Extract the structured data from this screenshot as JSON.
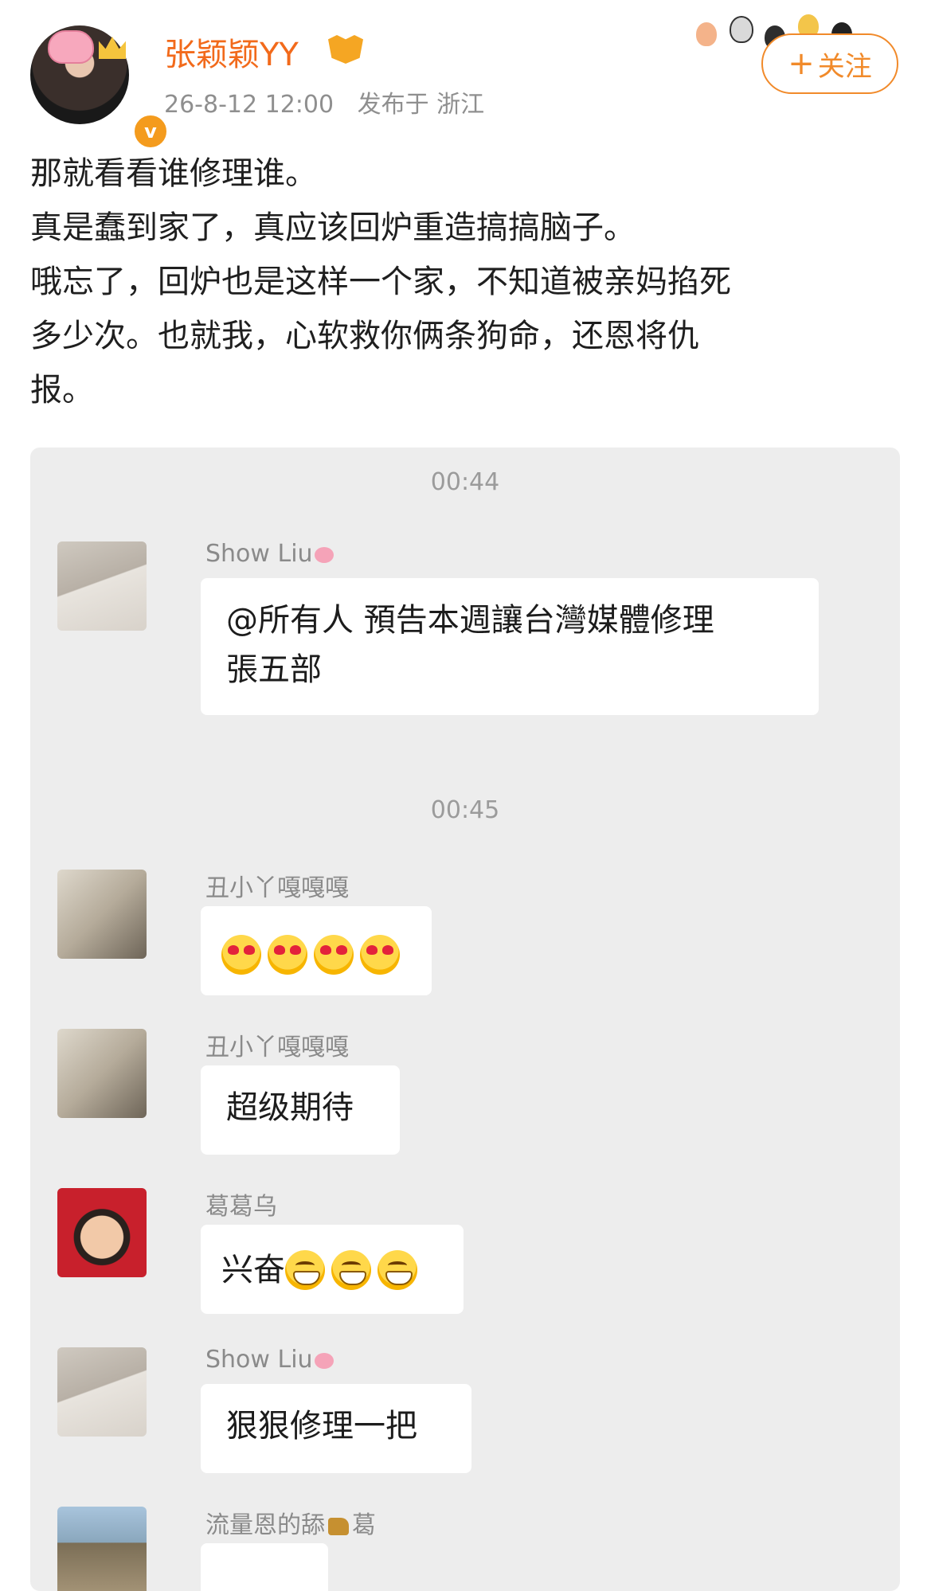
{
  "post": {
    "username": "张颖颖YY",
    "timestamp": "26-8-12 12:00",
    "location_prefix": "发布于",
    "location": "浙江",
    "follow_label": "关注",
    "follow_plus": "+",
    "verified_mark": "v",
    "lines": [
      "那就看看谁修理谁。",
      "真是蠢到家了，真应该回炉重造搞搞脑子。",
      "哦忘了，回炉也是这样一个家，不知道被亲妈掐死",
      "多少次。也就我，心软救你俩条狗命，还恩将仇",
      "报。"
    ]
  },
  "chat": {
    "time_1": "00:44",
    "time_2": "00:45",
    "messages": [
      {
        "sender": "Show Liu",
        "line1": "@所有人  預告本週讓台灣媒體修理",
        "line2": "張五部"
      },
      {
        "sender": "丑小丫嘎嘎嘎"
      },
      {
        "sender": "丑小丫嘎嘎嘎",
        "text": "超级期待"
      },
      {
        "sender": "葛葛乌",
        "text": "兴奋"
      },
      {
        "sender": "Show Liu",
        "text": "狠狠修理一把"
      },
      {
        "sender_a": "流量恩的舔",
        "sender_b": "葛"
      }
    ]
  },
  "colors": {
    "accent_orange": "#f26a1b",
    "follow_orange": "#f18a2a",
    "chat_bg": "#ededed",
    "bubble_bg": "#ffffff"
  },
  "icons": {
    "decorations": [
      "pig-badge-icon",
      "crown-icon",
      "verified-icon",
      "member-icon",
      "paw-icon",
      "heart-eyes-emoji",
      "grin-emoji",
      "pig-emoji",
      "dog-emoji"
    ]
  }
}
